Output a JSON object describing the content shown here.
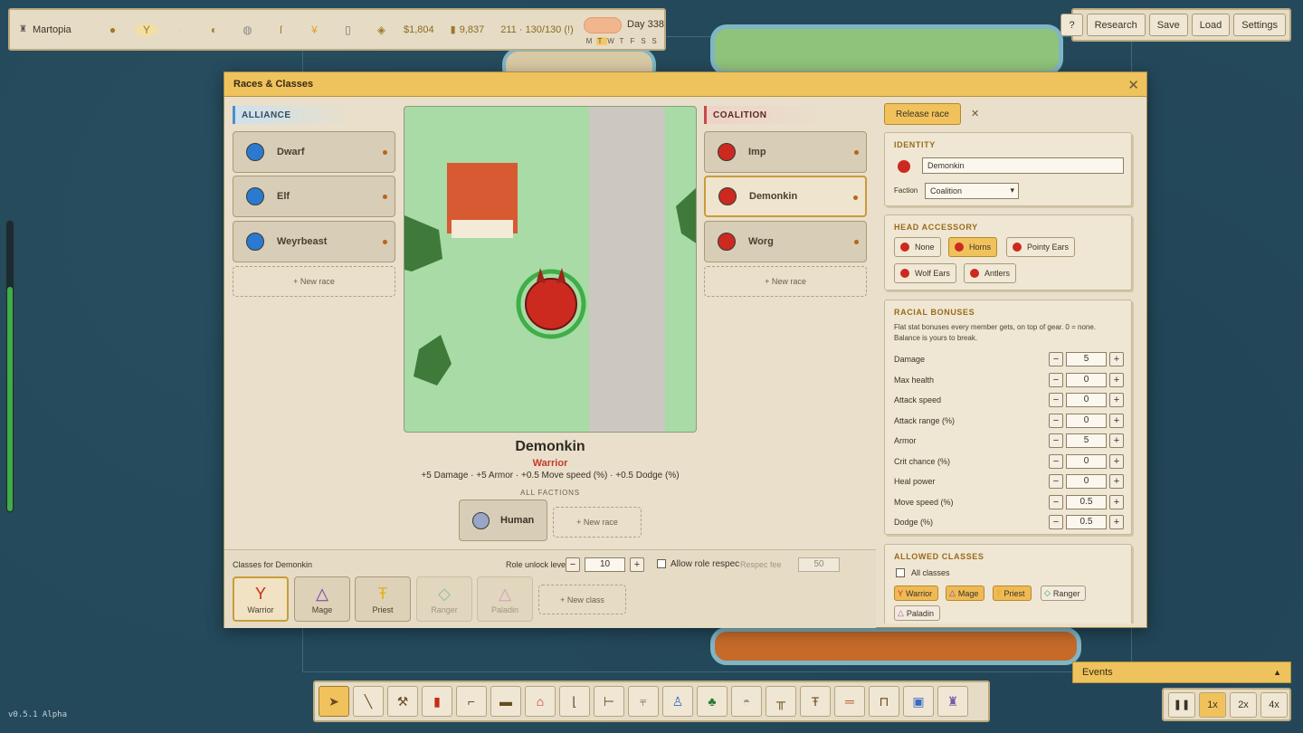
{
  "topbar": {
    "city_name": "Martopia",
    "money": "$1,804",
    "gold": "9,837",
    "population": "211 · 130/130 (!)",
    "day": "Day 338",
    "weekdays": [
      "M",
      "T",
      "W",
      "T",
      "F",
      "S",
      "S"
    ]
  },
  "topright": {
    "help": "?",
    "research": "Research",
    "save": "Save",
    "load": "Load",
    "settings": "Settings"
  },
  "version": "v0.5.1 Alpha",
  "modal": {
    "title": "Races & Classes",
    "alliance_label": "ALLIANCE",
    "coalition_label": "COALITION",
    "alliance_races": [
      "Dwarf",
      "Elf",
      "Weyrbeast"
    ],
    "coalition_races": [
      "Imp",
      "Demonkin",
      "Worg"
    ],
    "new_race": "+ New race",
    "preview": {
      "name": "Demonkin",
      "class": "Warrior",
      "bonuses": "+5 Damage · +5 Armor · +0.5 Move speed (%) · +0.5 Dodge (%)"
    },
    "all_factions": "ALL FACTIONS",
    "all_factions_races": [
      "Human"
    ],
    "classes_for": "Classes for Demonkin",
    "role_unlock_label": "Role unlock level",
    "role_unlock_value": "10",
    "allow_respec": "Allow role respec",
    "respec_fee_label": "Respec fee",
    "respec_fee_value": "50",
    "classes": [
      "Warrior",
      "Mage",
      "Priest",
      "Ranger",
      "Paladin"
    ],
    "new_class": "+ New class",
    "right": {
      "release_race": "Release race",
      "identity_title": "IDENTITY",
      "race_name": "Demonkin",
      "faction_label": "Faction",
      "faction_value": "Coalition",
      "head_title": "HEAD ACCESSORY",
      "head_options": [
        "None",
        "Horns",
        "Pointy Ears",
        "Wolf Ears",
        "Antlers"
      ],
      "head_selected": "Horns",
      "bonus_title": "RACIAL BONUSES",
      "bonus_desc": "Flat stat bonuses every member gets, on top of gear. 0 = none. Balance is yours to break.",
      "bonuses": [
        {
          "label": "Damage",
          "value": "5"
        },
        {
          "label": "Max health",
          "value": "0"
        },
        {
          "label": "Attack speed",
          "value": "0"
        },
        {
          "label": "Attack range (%)",
          "value": "0"
        },
        {
          "label": "Armor",
          "value": "5"
        },
        {
          "label": "Crit chance (%)",
          "value": "0"
        },
        {
          "label": "Heal power",
          "value": "0"
        },
        {
          "label": "Move speed (%)",
          "value": "0.5"
        },
        {
          "label": "Dodge (%)",
          "value": "0.5"
        }
      ],
      "allowed_title": "ALLOWED CLASSES",
      "all_classes": "All classes",
      "allowed_chips": [
        "Warrior",
        "Mage",
        "Priest",
        "Ranger",
        "Paladin"
      ]
    }
  },
  "events": "Events",
  "speeds": [
    "1x",
    "2x",
    "4x"
  ],
  "colors": {
    "accent": "#eec25d",
    "alliance": "#4a90c8",
    "coalition": "#c84a4a",
    "demon": "#cc2a1f"
  }
}
